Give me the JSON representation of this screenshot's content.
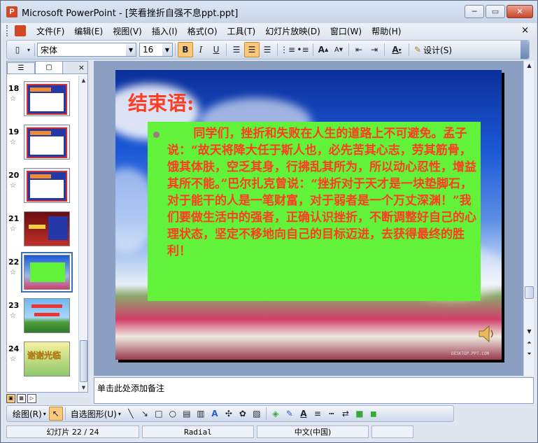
{
  "window": {
    "title": "Microsoft PowerPoint - [笑看挫折自强不息ppt.ppt]",
    "app_icon": "P",
    "controls": {
      "minimize": "─",
      "maximize": "▭",
      "close": "✕"
    }
  },
  "menubar": {
    "items": [
      "文件(F)",
      "编辑(E)",
      "视图(V)",
      "插入(I)",
      "格式(O)",
      "工具(T)",
      "幻灯片放映(D)",
      "窗口(W)",
      "帮助(H)"
    ],
    "close": "×"
  },
  "toolbar": {
    "font_name": "宋体",
    "font_size": "16",
    "bold": "B",
    "italic": "I",
    "underline": "U",
    "font_color_label": "A",
    "design_label": "设计(S)"
  },
  "left_pane": {
    "tab_outline": "☰",
    "tab_slides": "▢",
    "close": "×",
    "slides": [
      {
        "num": "18",
        "label": ""
      },
      {
        "num": "19",
        "label": ""
      },
      {
        "num": "20",
        "label": ""
      },
      {
        "num": "21",
        "label": ""
      },
      {
        "num": "22",
        "label": ""
      },
      {
        "num": "23",
        "label": ""
      },
      {
        "num": "24",
        "label": "谢谢光临"
      }
    ],
    "selected_slide": "22"
  },
  "slide": {
    "title": "结束语:",
    "body": "同学们，挫折和失败在人生的道路上不可避免。孟子说：“故天将降大任于斯人也，必先苦其心志，劳其筋骨，饿其体肤，空乏其身，行拂乱其所为，所以动心忍性，增益其所不能。”巴尔扎克曾说：“挫折对于天才是一块垫脚石，对于能干的人是一笔财富，对于弱者是一个万丈深渊！”我们要做生活中的强者，正确认识挫折，不断调整好自己的心理状态，坚定不移地向自己的目标迈进，去获得最终的胜利！",
    "watermark": "DESKTOP.PPT.COM",
    "colors": {
      "title": "#ff3b22",
      "text_box": "#62f23a"
    }
  },
  "notes": {
    "placeholder": "单击此处添加备注"
  },
  "drawbar": {
    "draw_label": "绘图(R)",
    "autoshape_label": "自选图形(U)"
  },
  "statusbar": {
    "slide_position": "幻灯片 22 / 24",
    "design": "Radial",
    "language": "中文(中国)"
  }
}
